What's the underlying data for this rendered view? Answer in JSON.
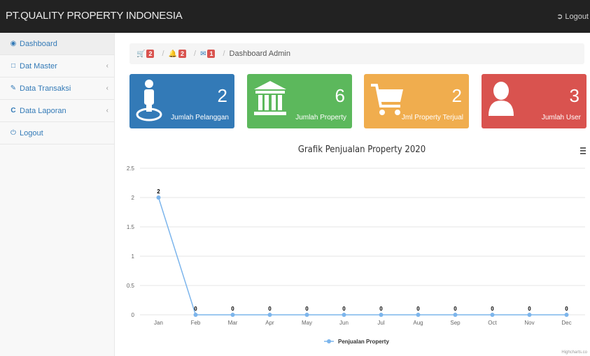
{
  "app": {
    "title": "PT.QUALITY PROPERTY INDONESIA",
    "logout_label": "Logout"
  },
  "sidebar": {
    "items": [
      {
        "label": "Dashboard",
        "icon": "dashboard-icon",
        "active": true
      },
      {
        "label": "Dat Master",
        "icon": "laptop-icon",
        "has_submenu": true
      },
      {
        "label": "Data Transaksi",
        "icon": "edit-icon",
        "has_submenu": true
      },
      {
        "label": "Data Laporan",
        "icon": "refresh-icon",
        "has_submenu": true
      },
      {
        "label": "Logout",
        "icon": "power-icon"
      }
    ]
  },
  "breadcrumb": {
    "cart_count": "2",
    "bell_count": "2",
    "mail_count": "1",
    "current": "Dashboard Admin"
  },
  "cards": [
    {
      "value": "2",
      "label": "Jumlah Pelanggan",
      "icon": "user-icon",
      "color": "#337ab7"
    },
    {
      "value": "6",
      "label": "Jumlah Property",
      "icon": "bank-icon",
      "color": "#5cb85c"
    },
    {
      "value": "2",
      "label": "Jml Property Terjual",
      "icon": "cart-icon",
      "color": "#f0ad4e"
    },
    {
      "value": "3",
      "label": "Jumlah User",
      "icon": "person-icon",
      "color": "#d9534f"
    }
  ],
  "chart_data": {
    "type": "line",
    "title": "Grafik Penjualan Property 2020",
    "categories": [
      "Jan",
      "Feb",
      "Mar",
      "Apr",
      "May",
      "Jun",
      "Jul",
      "Aug",
      "Sep",
      "Oct",
      "Nov",
      "Dec"
    ],
    "series": [
      {
        "name": "Penjualan Property",
        "values": [
          2,
          0,
          0,
          0,
          0,
          0,
          0,
          0,
          0,
          0,
          0,
          0
        ],
        "color": "#7cb5ec"
      }
    ],
    "y_ticks": [
      "0",
      "0.5",
      "1",
      "1.5",
      "2",
      "2.5"
    ],
    "ylim": [
      0,
      2.5
    ],
    "grid": true,
    "legend": "bottom-center",
    "credits": "Highcharts.co"
  }
}
